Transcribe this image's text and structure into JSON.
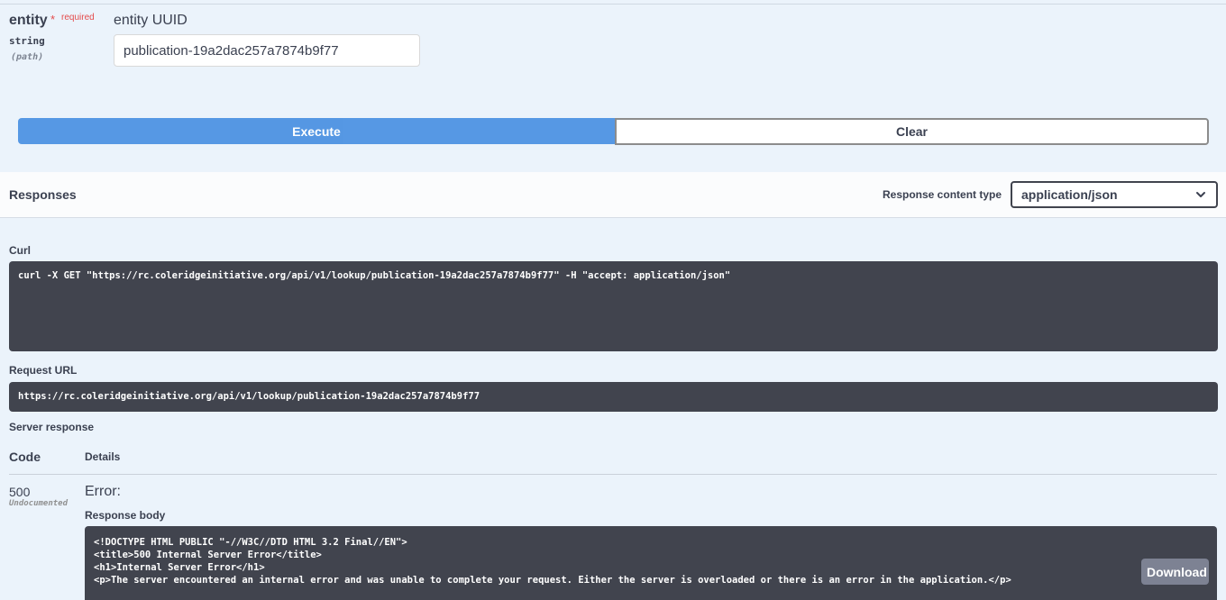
{
  "parameter": {
    "name": "entity",
    "required_star": "*",
    "required_label": "required",
    "type": "string",
    "location": "(path)",
    "description": "entity UUID",
    "value": "publication-19a2dac257a7874b9f77"
  },
  "actions": {
    "execute_label": "Execute",
    "clear_label": "Clear"
  },
  "responses": {
    "title": "Responses",
    "content_type_label": "Response content type",
    "content_type_value": "application/json"
  },
  "curl": {
    "label": "Curl",
    "command": "curl -X GET \"https://rc.coleridgeinitiative.org/api/v1/lookup/publication-19a2dac257a7874b9f77\" -H \"accept: application/json\""
  },
  "request_url": {
    "label": "Request URL",
    "url": "https://rc.coleridgeinitiative.org/api/v1/lookup/publication-19a2dac257a7874b9f77"
  },
  "server_response": {
    "label": "Server response",
    "code_header": "Code",
    "details_header": "Details",
    "code": "500",
    "code_note": "Undocumented",
    "error_title": "Error:",
    "body_label": "Response body",
    "body_lines": [
      "<!DOCTYPE HTML PUBLIC \"-//W3C//DTD HTML 3.2 Final//EN\">",
      "<title>500 Internal Server Error</title>",
      "<h1>Internal Server Error</h1>",
      "<p>The server encountered an internal error and was unable to complete your request. Either the server is overloaded or there is an error in the application.</p>"
    ],
    "download_label": "Download"
  },
  "colors": {
    "execute": "#4990e2",
    "code_bg": "#41444e",
    "required": "#e44c4c",
    "page_bg": "#ebf3fb"
  },
  "icons": {
    "select_chevron": "chevron-down-icon"
  }
}
